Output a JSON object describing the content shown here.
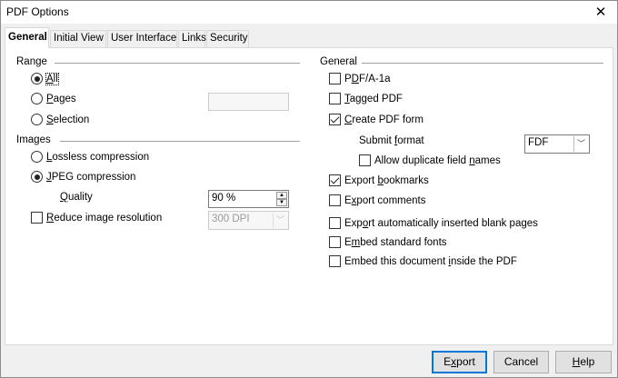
{
  "window": {
    "title": "PDF Options",
    "close_glyph": "✕"
  },
  "tabs": [
    "General",
    "Initial View",
    "User Interface",
    "Links",
    "Security"
  ],
  "range": {
    "heading": "Range",
    "all": {
      "pre": "",
      "mn": "A",
      "post": "ll"
    },
    "pages": {
      "pre": "",
      "mn": "P",
      "post": "ages"
    },
    "selection": {
      "pre": "",
      "mn": "S",
      "post": "election"
    },
    "pages_value": ""
  },
  "images": {
    "heading": "Images",
    "lossless": {
      "pre": "",
      "mn": "L",
      "post": "ossless compression"
    },
    "jpeg": {
      "pre": "",
      "mn": "J",
      "post": "PEG compression"
    },
    "quality": {
      "pre": "",
      "mn": "Q",
      "post": "uality"
    },
    "quality_value": "90 %",
    "reduce": {
      "pre": "",
      "mn": "R",
      "post": "educe image resolution"
    },
    "dpi_value": "300 DPI"
  },
  "general": {
    "heading": "General",
    "pdfa": {
      "pre": "P",
      "mn": "D",
      "post": "F/A-1a"
    },
    "tagged": {
      "pre": "",
      "mn": "T",
      "post": "agged PDF"
    },
    "create_form": {
      "pre": "",
      "mn": "C",
      "post": "reate PDF form"
    },
    "submit_format": {
      "pre": "Submit ",
      "mn": "f",
      "post": "ormat"
    },
    "submit_format_value": "FDF",
    "allow_duplicate": {
      "pre": "Allow duplicate field ",
      "mn": "n",
      "post": "ames"
    },
    "export_bookmarks": {
      "pre": "Export ",
      "mn": "b",
      "post": "ookmarks"
    },
    "export_comments": {
      "pre": "E",
      "mn": "x",
      "post": "port comments"
    },
    "export_blank": {
      "pre": "Exp",
      "mn": "o",
      "post": "rt automatically inserted blank pages"
    },
    "embed_fonts": {
      "pre": "E",
      "mn": "m",
      "post": "bed standard fonts"
    },
    "embed_doc": {
      "pre": "Embed this document ",
      "mn": "i",
      "post": "nside the PDF"
    }
  },
  "buttons": {
    "export": {
      "pre": "E",
      "mn": "x",
      "post": "port"
    },
    "cancel": "Cancel",
    "help": {
      "pre": "",
      "mn": "H",
      "post": "elp"
    }
  }
}
